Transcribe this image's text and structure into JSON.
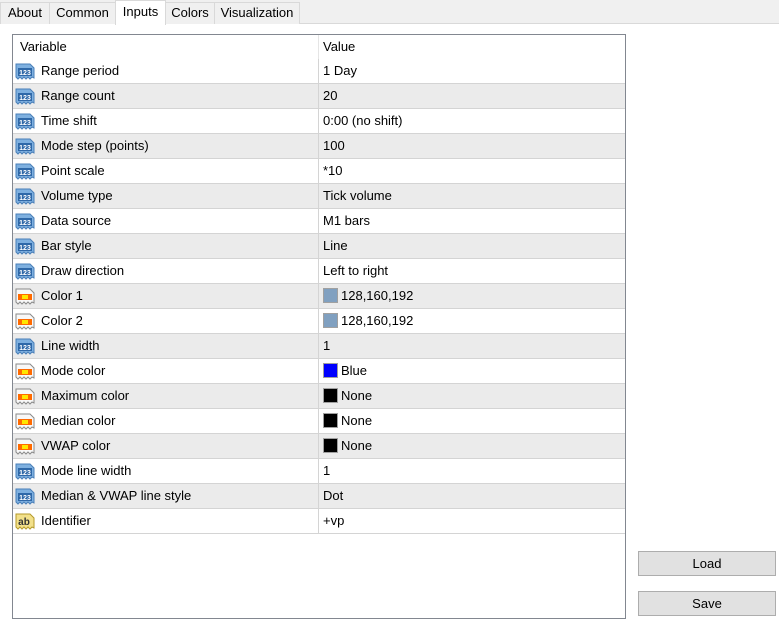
{
  "tabs": [
    {
      "label": "About",
      "active": false
    },
    {
      "label": "Common",
      "active": false
    },
    {
      "label": "Inputs",
      "active": true
    },
    {
      "label": "Colors",
      "active": false
    },
    {
      "label": "Visualization",
      "active": false
    }
  ],
  "grid": {
    "columns": [
      "Variable",
      "Value"
    ],
    "rows": [
      {
        "icon": "number-icon",
        "name": "Range period",
        "value": "1 Day"
      },
      {
        "icon": "number-icon",
        "name": "Range count",
        "value": "20"
      },
      {
        "icon": "number-icon",
        "name": "Time shift",
        "value": "0:00 (no shift)"
      },
      {
        "icon": "number-icon",
        "name": "Mode step (points)",
        "value": "100"
      },
      {
        "icon": "number-icon",
        "name": "Point scale",
        "value": "*10"
      },
      {
        "icon": "number-icon",
        "name": "Volume type",
        "value": "Tick volume"
      },
      {
        "icon": "number-icon",
        "name": "Data source",
        "value": "M1 bars"
      },
      {
        "icon": "number-icon",
        "name": "Bar style",
        "value": "Line"
      },
      {
        "icon": "number-icon",
        "name": "Draw direction",
        "value": "Left to right"
      },
      {
        "icon": "color-icon",
        "name": "Color 1",
        "value": "128,160,192",
        "swatch": "#80a0c0"
      },
      {
        "icon": "color-icon",
        "name": "Color 2",
        "value": "128,160,192",
        "swatch": "#80a0c0"
      },
      {
        "icon": "number-icon",
        "name": "Line width",
        "value": "1"
      },
      {
        "icon": "color-icon",
        "name": "Mode color",
        "value": "Blue",
        "swatch": "#0000ff"
      },
      {
        "icon": "color-icon",
        "name": "Maximum color",
        "value": "None",
        "swatch": "#000000"
      },
      {
        "icon": "color-icon",
        "name": "Median color",
        "value": "None",
        "swatch": "#000000"
      },
      {
        "icon": "color-icon",
        "name": "VWAP color",
        "value": "None",
        "swatch": "#000000"
      },
      {
        "icon": "number-icon",
        "name": "Mode line width",
        "value": "1"
      },
      {
        "icon": "number-icon",
        "name": "Median & VWAP line style",
        "value": "Dot"
      },
      {
        "icon": "string-icon",
        "name": "Identifier",
        "value": "+vp"
      }
    ]
  },
  "buttons": {
    "load": "Load",
    "save": "Save"
  }
}
